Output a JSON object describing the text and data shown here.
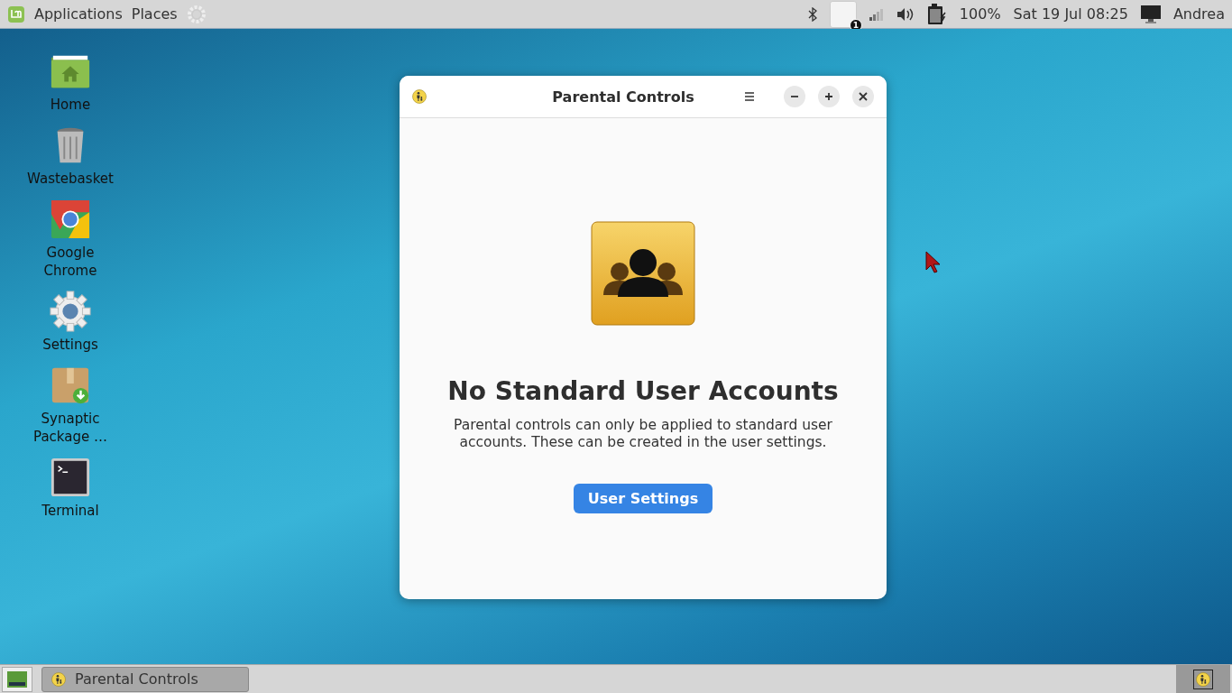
{
  "top_panel": {
    "menus": [
      "Applications",
      "Places"
    ],
    "mail_badge": "1",
    "battery": "100%",
    "clock": "Sat 19 Jul 08:25",
    "user": "Andrea"
  },
  "desktop_icons": [
    {
      "kind": "home",
      "label": "Home"
    },
    {
      "kind": "trash",
      "label": "Wastebasket"
    },
    {
      "kind": "chrome",
      "label": "Google Chrome"
    },
    {
      "kind": "settings",
      "label": "Settings"
    },
    {
      "kind": "package",
      "label": "Synaptic Package …"
    },
    {
      "kind": "terminal",
      "label": "Terminal"
    }
  ],
  "window": {
    "title": "Parental Controls",
    "heading": "No Standard User Accounts",
    "message": "Parental controls can only be applied to standard user accounts. These can be created in the user settings.",
    "button": "User Settings"
  },
  "taskbar": {
    "tasks": [
      {
        "label": "Parental Controls",
        "selected": true
      }
    ]
  }
}
